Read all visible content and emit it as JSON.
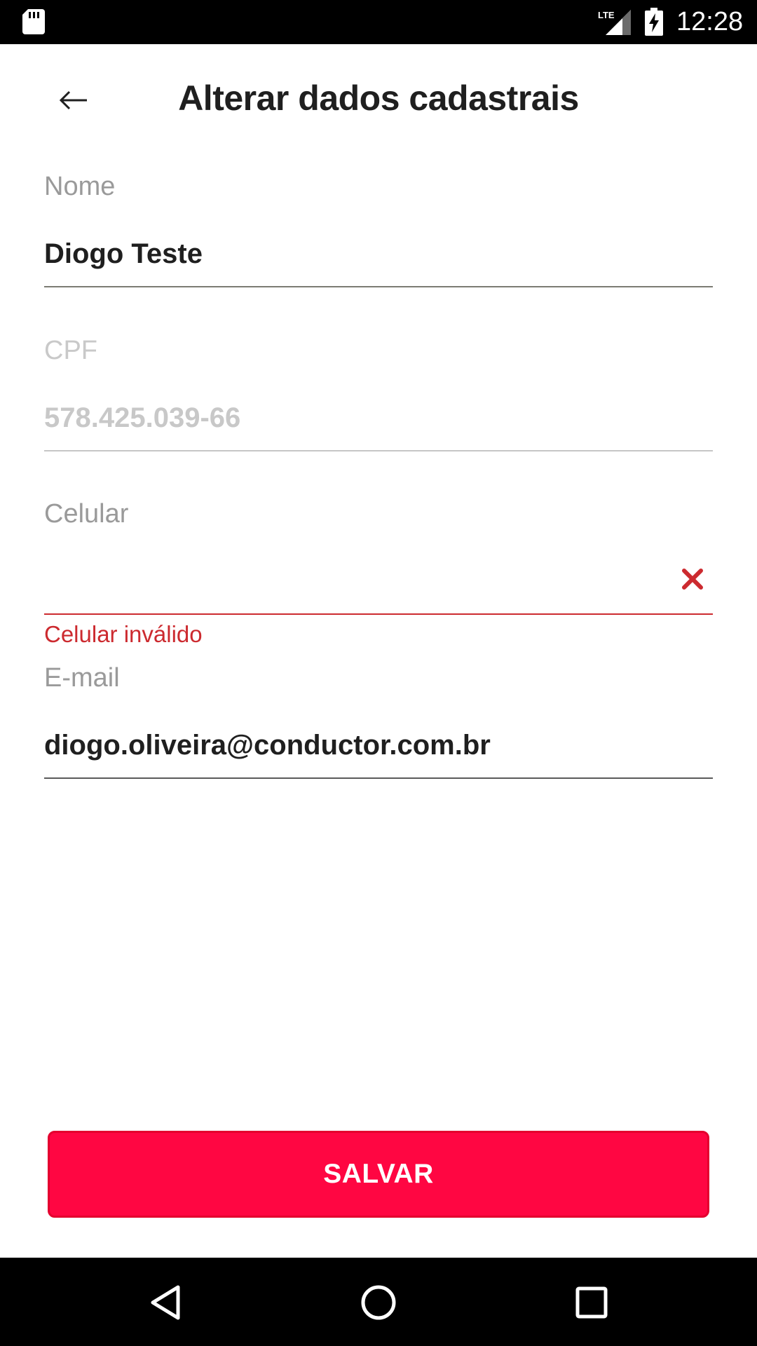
{
  "status_bar": {
    "time": "12:28",
    "network": "LTE",
    "icons": [
      "sd-card-icon",
      "lte-signal-icon",
      "battery-charging-icon"
    ]
  },
  "app_bar": {
    "back_icon": "arrow-left-icon",
    "title": "Alterar dados cadastrais"
  },
  "form": {
    "name": {
      "label": "Nome",
      "value": "Diogo Teste"
    },
    "cpf": {
      "label": "CPF",
      "value": "578.425.039-66",
      "disabled": true
    },
    "phone": {
      "label": "Celular",
      "value": "",
      "error": "Celular inválido",
      "clear_icon": "close-icon"
    },
    "email": {
      "label": "E-mail",
      "value": "diogo.oliveira@conductor.com.br"
    }
  },
  "actions": {
    "save_label": "SALVAR"
  },
  "nav_bar": {
    "icons": [
      "nav-back-icon",
      "nav-home-icon",
      "nav-recents-icon"
    ]
  },
  "colors": {
    "accent": "#ff0642",
    "error": "#cc2a2f",
    "label": "#9a9a9a",
    "disabled": "#c8c8c8",
    "text": "#1f1f1f"
  }
}
